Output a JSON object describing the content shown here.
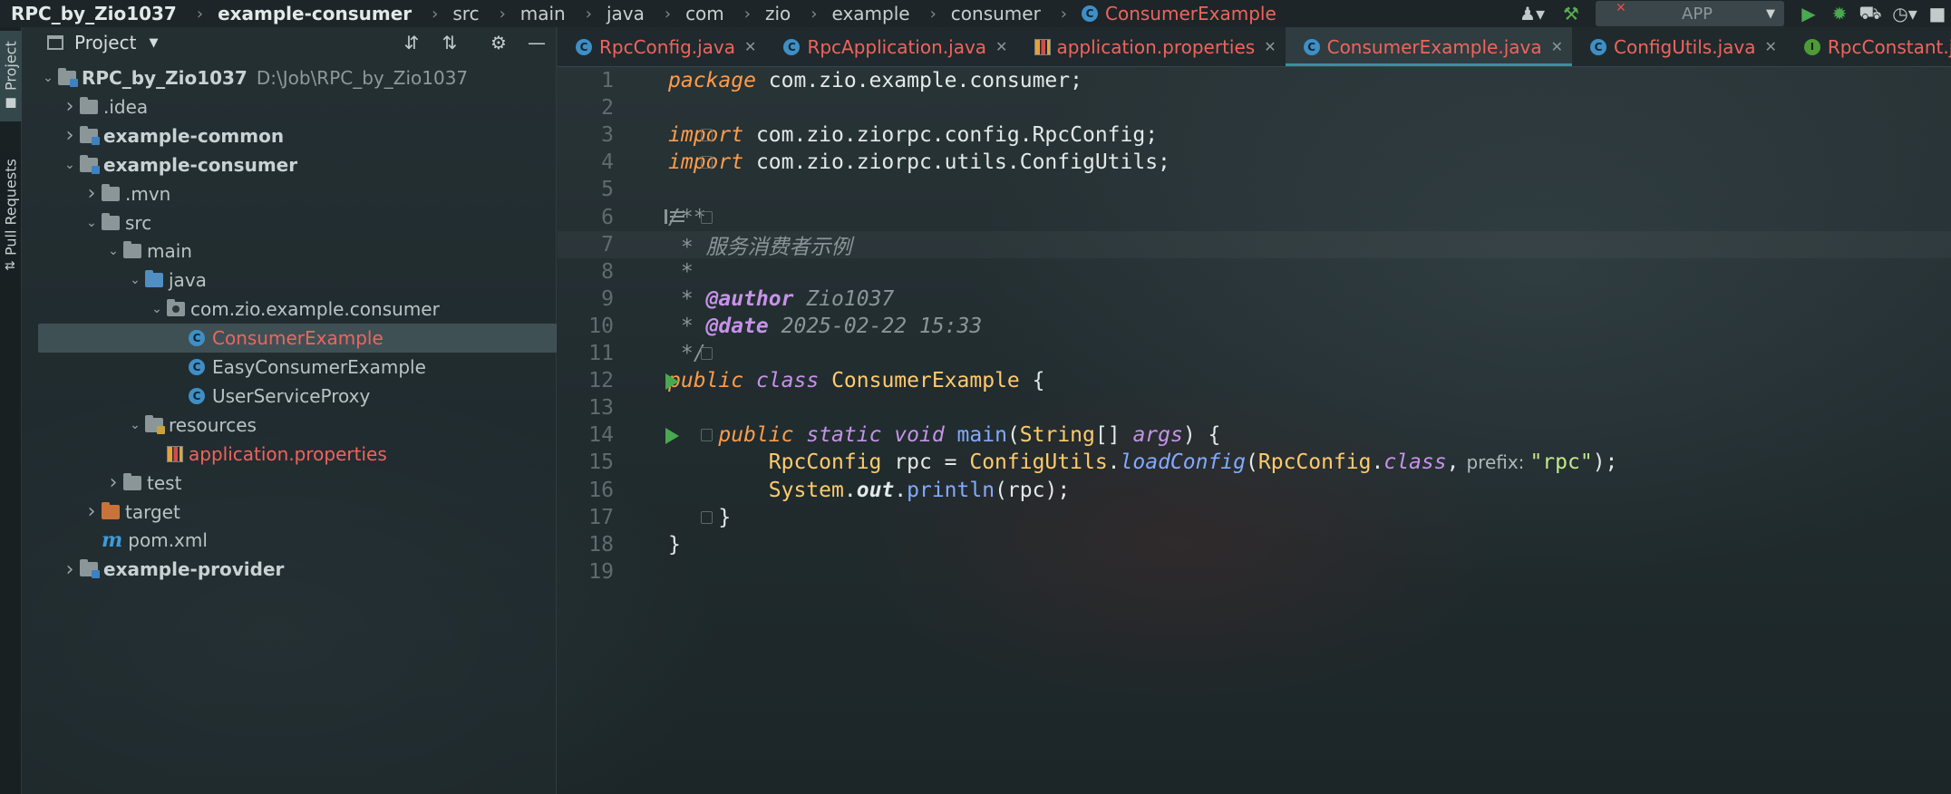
{
  "breadcrumb": [
    "RPC_by_Zio1037",
    "example-consumer",
    "src",
    "main",
    "java",
    "com",
    "zio",
    "example",
    "consumer",
    "ConsumerExample"
  ],
  "run_config": {
    "label": "APP"
  },
  "tool_stripe": {
    "project": "Project",
    "pull_requests": "Pull Requests"
  },
  "project_panel": {
    "title": "Project",
    "tree": [
      {
        "label": "RPC_by_Zio1037",
        "path": "D:\\Job\\RPC_by_Zio1037",
        "indent": 0,
        "arrow": "v",
        "icon": "module-folder",
        "bold": true
      },
      {
        "label": ".idea",
        "indent": 1,
        "arrow": ">",
        "icon": "folder"
      },
      {
        "label": "example-common",
        "indent": 1,
        "arrow": ">",
        "icon": "module-folder",
        "bold": true
      },
      {
        "label": "example-consumer",
        "indent": 1,
        "arrow": "v",
        "icon": "module-folder",
        "bold": true
      },
      {
        "label": ".mvn",
        "indent": 2,
        "arrow": ">",
        "icon": "folder"
      },
      {
        "label": "src",
        "indent": 2,
        "arrow": "v",
        "icon": "folder"
      },
      {
        "label": "main",
        "indent": 3,
        "arrow": "v",
        "icon": "folder"
      },
      {
        "label": "java",
        "indent": 4,
        "arrow": "v",
        "icon": "source-folder"
      },
      {
        "label": "com.zio.example.consumer",
        "indent": 5,
        "arrow": "v",
        "icon": "package"
      },
      {
        "label": "ConsumerExample",
        "indent": 6,
        "arrow": "",
        "icon": "class",
        "selected": true,
        "red": true
      },
      {
        "label": "EasyConsumerExample",
        "indent": 6,
        "arrow": "",
        "icon": "class"
      },
      {
        "label": "UserServiceProxy",
        "indent": 6,
        "arrow": "",
        "icon": "class"
      },
      {
        "label": "resources",
        "indent": 4,
        "arrow": "v",
        "icon": "resources-folder"
      },
      {
        "label": "application.properties",
        "indent": 5,
        "arrow": "",
        "icon": "properties",
        "red": true
      },
      {
        "label": "test",
        "indent": 3,
        "arrow": ">",
        "icon": "folder"
      },
      {
        "label": "target",
        "indent": 2,
        "arrow": ">",
        "icon": "excluded-folder"
      },
      {
        "label": "pom.xml",
        "indent": 2,
        "arrow": "",
        "icon": "maven"
      },
      {
        "label": "example-provider",
        "indent": 1,
        "arrow": ">",
        "icon": "module-folder",
        "bold": true
      }
    ]
  },
  "tabs": [
    {
      "label": "RpcConfig.java",
      "icon": "class"
    },
    {
      "label": "RpcApplication.java",
      "icon": "class"
    },
    {
      "label": "application.properties",
      "icon": "properties"
    },
    {
      "label": "ConsumerExample.java",
      "icon": "class",
      "active": true
    },
    {
      "label": "ConfigUtils.java",
      "icon": "class"
    },
    {
      "label": "RpcConstant.java",
      "icon": "interface"
    }
  ],
  "code": {
    "line_numbers": [
      "1",
      "2",
      "3",
      "4",
      "5",
      "6",
      "7",
      "8",
      "9",
      "10",
      "11",
      "12",
      "13",
      "14",
      "15",
      "16",
      "17",
      "18",
      "19"
    ],
    "lines": [
      [
        [
          "kw",
          "package"
        ],
        [
          "pl",
          " com.zio.example.consumer;"
        ]
      ],
      [],
      [
        [
          "kw",
          "import"
        ],
        [
          "pl",
          " com.zio.ziorpc.config.RpcConfig;"
        ]
      ],
      [
        [
          "kw",
          "import"
        ],
        [
          "pl",
          " com.zio.ziorpc.utils.ConfigUtils;"
        ]
      ],
      [],
      [
        [
          "cm",
          "/**"
        ]
      ],
      [
        [
          "cm",
          " * 服务消费者示例"
        ]
      ],
      [
        [
          "cm",
          " *"
        ]
      ],
      [
        [
          "cm",
          " * "
        ],
        [
          "tag",
          "@author"
        ],
        [
          "cm",
          " Zio1037"
        ]
      ],
      [
        [
          "cm",
          " * "
        ],
        [
          "tag",
          "@date"
        ],
        [
          "cm",
          " 2025-02-22 15:33"
        ]
      ],
      [
        [
          "cm",
          " */"
        ]
      ],
      [
        [
          "kw",
          "public"
        ],
        [
          "pl",
          " "
        ],
        [
          "kw2",
          "class"
        ],
        [
          "pl",
          " "
        ],
        [
          "ty",
          "ConsumerExample"
        ],
        [
          "pl",
          " {"
        ]
      ],
      [],
      [
        [
          "pl",
          "    "
        ],
        [
          "kw",
          "public"
        ],
        [
          "pl",
          " "
        ],
        [
          "kw2",
          "static"
        ],
        [
          "pl",
          " "
        ],
        [
          "kw2",
          "void"
        ],
        [
          "pl",
          " "
        ],
        [
          "fn",
          "main"
        ],
        [
          "pl",
          "("
        ],
        [
          "ty",
          "String"
        ],
        [
          "pl",
          "[] "
        ],
        [
          "kw2",
          "args"
        ],
        [
          "pl",
          ") {"
        ]
      ],
      [
        [
          "pl",
          "        "
        ],
        [
          "ty",
          "RpcConfig"
        ],
        [
          "pl",
          " rpc = "
        ],
        [
          "ty",
          "ConfigUtils"
        ],
        [
          "pl",
          "."
        ],
        [
          "fni",
          "loadConfig"
        ],
        [
          "pl",
          "("
        ],
        [
          "ty",
          "RpcConfig"
        ],
        [
          "pl",
          "."
        ],
        [
          "kw2",
          "class"
        ],
        [
          "pl",
          ","
        ],
        [
          "hint",
          "prefix:"
        ],
        [
          "str",
          "\"rpc\""
        ],
        [
          "pl",
          ");"
        ]
      ],
      [
        [
          "pl",
          "        "
        ],
        [
          "ty",
          "System"
        ],
        [
          "pl",
          "."
        ],
        [
          "bold-i",
          "out"
        ],
        [
          "pl",
          "."
        ],
        [
          "fn",
          "println"
        ],
        [
          "pl",
          "(rpc);"
        ]
      ],
      [
        [
          "pl",
          "    }"
        ]
      ],
      [
        [
          "pl",
          "}"
        ]
      ],
      []
    ]
  }
}
